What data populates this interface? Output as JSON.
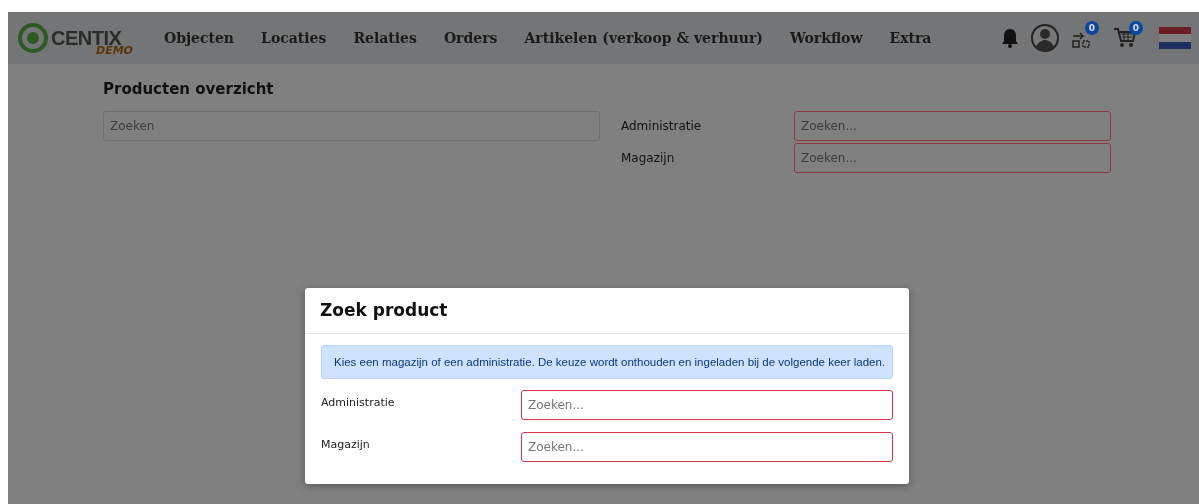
{
  "navbar": {
    "logo": {
      "name": "CENTIX",
      "tag": "DEMO"
    },
    "menu": [
      "Objecten",
      "Locaties",
      "Relaties",
      "Orders",
      "Artikelen (verkoop & verhuur)",
      "Workflow",
      "Extra"
    ],
    "compare_badge": "0",
    "cart_badge": "0"
  },
  "page": {
    "title": "Producten overzicht",
    "search": {
      "placeholder": "Zoeken",
      "invalid": false
    },
    "filters": [
      {
        "label": "Administratie",
        "placeholder": "Zoeken...",
        "invalid": true
      },
      {
        "label": "Magazijn",
        "placeholder": "Zoeken...",
        "invalid": true
      }
    ]
  },
  "modal": {
    "title": "Zoek product",
    "info": "Kies een magazijn of een administratie. De keuze wordt onthouden en ingeladen bij de volgende keer laden.",
    "fields": [
      {
        "label": "Administratie",
        "placeholder": "Zoeken...",
        "invalid": true
      },
      {
        "label": "Magazijn",
        "placeholder": "Zoeken...",
        "invalid": true
      }
    ]
  }
}
